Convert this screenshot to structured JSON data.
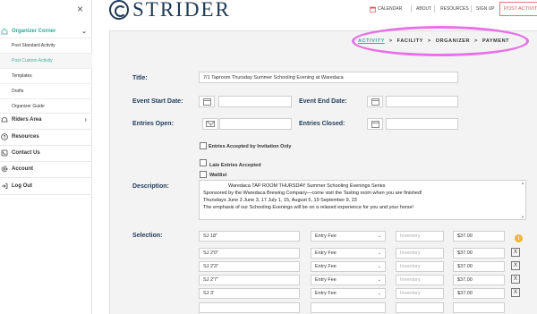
{
  "sidebar": {
    "close_label": "×",
    "organizer_corner": "Organizer Corner",
    "sub_items": [
      "Post Standard Activity",
      "Post Custom Activity",
      "Templates",
      "Drafts",
      "Organizer Guide"
    ],
    "riders_area": "Riders Area",
    "resources": "Resources",
    "contact_us": "Contact Us",
    "account": "Account",
    "log_out": "Log Out"
  },
  "header": {
    "logo_text": "STRIDER",
    "nav": {
      "calendar": "CALENDAR",
      "about": "ABOUT",
      "resources": "RESOURCES",
      "sign_up": "SIGN UP"
    },
    "post_activity": "POST ACTIVITY"
  },
  "steps": {
    "activity": "ACTIVITY",
    "sep": ">",
    "facility": "FACILITY",
    "organizer": "ORGANIZER",
    "payment": "PAYMENT"
  },
  "form": {
    "title_label": "Title:",
    "title_value": "7/1 Taproom Thursday Summer Schooling Evening at Waredaca",
    "start_date_label": "Event Start Date:",
    "end_date_label": "Event End Date:",
    "entries_open_label": "Entries Open:",
    "entries_closed_label": "Entries Closed:",
    "by_invitation": "Entries Accepted by Invitation Only",
    "late_entries": "Late Entries Accepted",
    "waitlist": "Waitlist",
    "description_label": "Description:",
    "description_lines": [
      "Waredaca TAP ROOM THURSDAY Summer Schooling Evenings Series",
      "Sponsored by the Waredaca Brewing Company—come visit the Tasting room when you are finished!",
      "Thursdays June 3 June 3, 17 July 1, 15, August 5, 19 September 9, 23",
      "The emphasis of our Schooling Evenings will be on a relaxed experience for you and your horse!"
    ],
    "selection_label": "Selection:",
    "rows": [
      {
        "name": "SJ 18\"",
        "fee_type": "Entry Fee",
        "inventory": "Inventory",
        "price": "$37.00"
      },
      {
        "name": "SJ 2'0\"",
        "fee_type": "Entry Fee",
        "inventory": "Inventory",
        "price": "$37.00"
      },
      {
        "name": "SJ 2'3\"",
        "fee_type": "Entry Fee",
        "inventory": "Inventory",
        "price": "$37.00"
      },
      {
        "name": "SJ 2'7\"",
        "fee_type": "Entry Fee",
        "inventory": "Inventory",
        "price": "$37.00"
      },
      {
        "name": "SJ 3'",
        "fee_type": "Entry Fee",
        "inventory": "Inventory",
        "price": "$37.00"
      }
    ],
    "remove_label": "X",
    "info_icon": "i"
  }
}
